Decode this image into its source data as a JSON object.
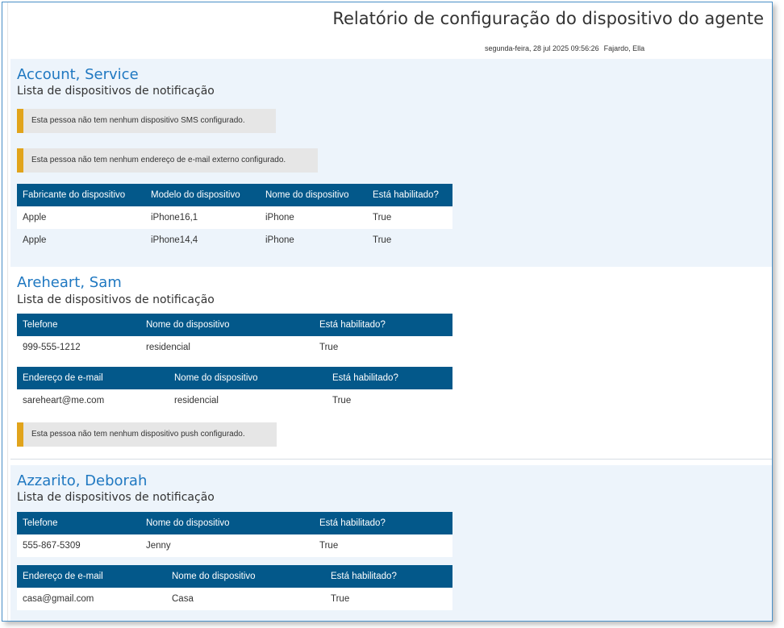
{
  "header": {
    "title": "Relatório de configuração do dispositivo do agente",
    "date": "segunda-feira, 28 jul 2025 09:56:26",
    "user": "Fajardo, Ella"
  },
  "people": [
    {
      "name": "Account, Service",
      "subtitle": "Lista de dispositivos de notificação",
      "notices": [
        "Esta pessoa não tem nenhum dispositivo SMS configurado.",
        "Esta pessoa não tem nenhum endereço de e-mail externo configurado."
      ],
      "push_table": {
        "headers": [
          "Fabricante do dispositivo",
          "Modelo do dispositivo",
          "Nome do dispositivo",
          "Está habilitado?"
        ],
        "rows": [
          [
            "Apple",
            "iPhone16,1",
            "iPhone",
            "True"
          ],
          [
            "Apple",
            "iPhone14,4",
            "iPhone",
            "True"
          ]
        ]
      }
    },
    {
      "name": "Areheart, Sam",
      "subtitle": "Lista de dispositivos de notificação",
      "phone_table": {
        "headers": [
          "Telefone",
          "Nome do dispositivo",
          "Está habilitado?"
        ],
        "rows": [
          [
            "999-555-1212",
            "residencial",
            "True"
          ]
        ]
      },
      "email_table": {
        "headers": [
          "Endereço de e-mail",
          "Nome do dispositivo",
          "Está habilitado?"
        ],
        "rows": [
          [
            "sareheart@me.com",
            "residencial",
            "True"
          ]
        ]
      },
      "notices": [
        "Esta pessoa não tem nenhum dispositivo push configurado."
      ]
    },
    {
      "name": "Azzarito, Deborah",
      "subtitle": "Lista de dispositivos de notificação",
      "phone_table": {
        "headers": [
          "Telefone",
          "Nome do dispositivo",
          "Está habilitado?"
        ],
        "rows": [
          [
            "555-867-5309",
            "Jenny",
            "True"
          ]
        ]
      },
      "email_table": {
        "headers": [
          "Endereço de e-mail",
          "Nome do dispositivo",
          "Está habilitado?"
        ],
        "rows": [
          [
            "casa@gmail.com",
            "Casa",
            "True"
          ]
        ]
      }
    }
  ],
  "colors": {
    "header_bg": "#03588a",
    "name_blue": "#1f78c1",
    "notice_accent": "#e1a41c",
    "section_shade": "#edf4fb"
  }
}
